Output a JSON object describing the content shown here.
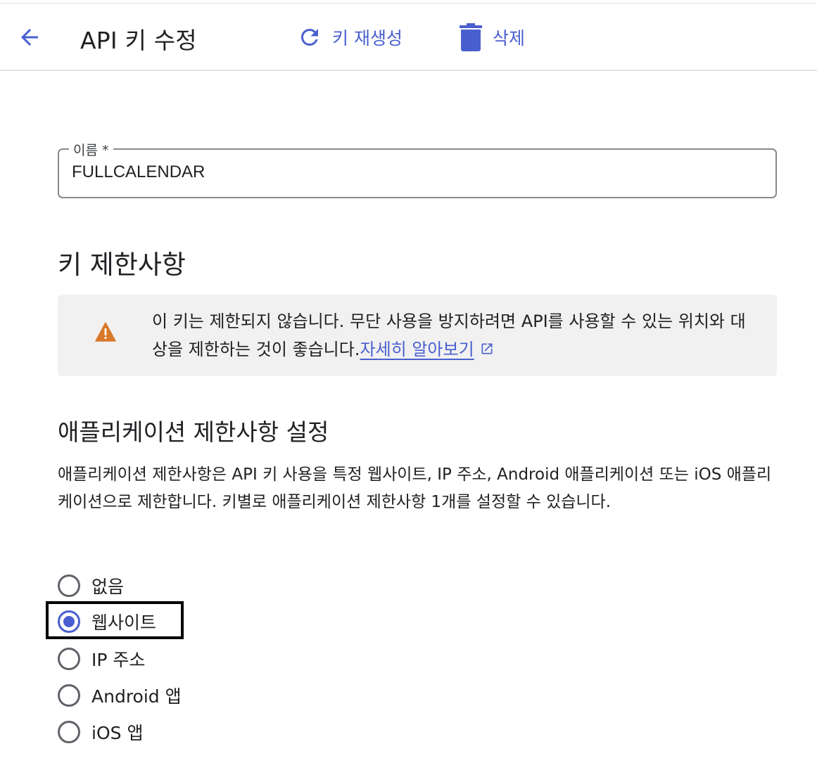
{
  "header": {
    "title": "API 키 수정",
    "back_icon": "arrow-left-icon",
    "actions": {
      "regenerate": {
        "label": "키 재생성",
        "icon": "refresh-icon"
      },
      "delete": {
        "label": "삭제",
        "icon": "trash-icon"
      }
    }
  },
  "name_field": {
    "label": "이름 *",
    "value": "FULLCALENDAR"
  },
  "key_restrictions": {
    "title": "키 제한사항",
    "warning": {
      "icon": "warning-icon",
      "text": "이 키는 제한되지 않습니다. 무단 사용을 방지하려면 API를 사용할 수 있는 위치와 대상을 제한하는 것이 좋습니다.",
      "link": "자세히 알아보기",
      "link_icon": "external-link-icon"
    }
  },
  "app_restrictions": {
    "title": "애플리케이션 제한사항 설정",
    "description": "애플리케이션 제한사항은 API 키 사용을 특정 웹사이트, IP 주소, Android 애플리케이션 또는 iOS 애플리케이션으로 제한합니다. 키별로 애플리케이션 제한사항 1개를 설정할 수 있습니다.",
    "options": [
      {
        "label": "없음",
        "checked": false
      },
      {
        "label": "웹사이트",
        "checked": true
      },
      {
        "label": "IP 주소",
        "checked": false
      },
      {
        "label": "Android 앱",
        "checked": false
      },
      {
        "label": "iOS 앱",
        "checked": false
      }
    ]
  },
  "colors": {
    "accent": "#4a5fcf",
    "warning": "#d9792b",
    "text": "#202124",
    "warning_bg": "#f1f1f1"
  }
}
